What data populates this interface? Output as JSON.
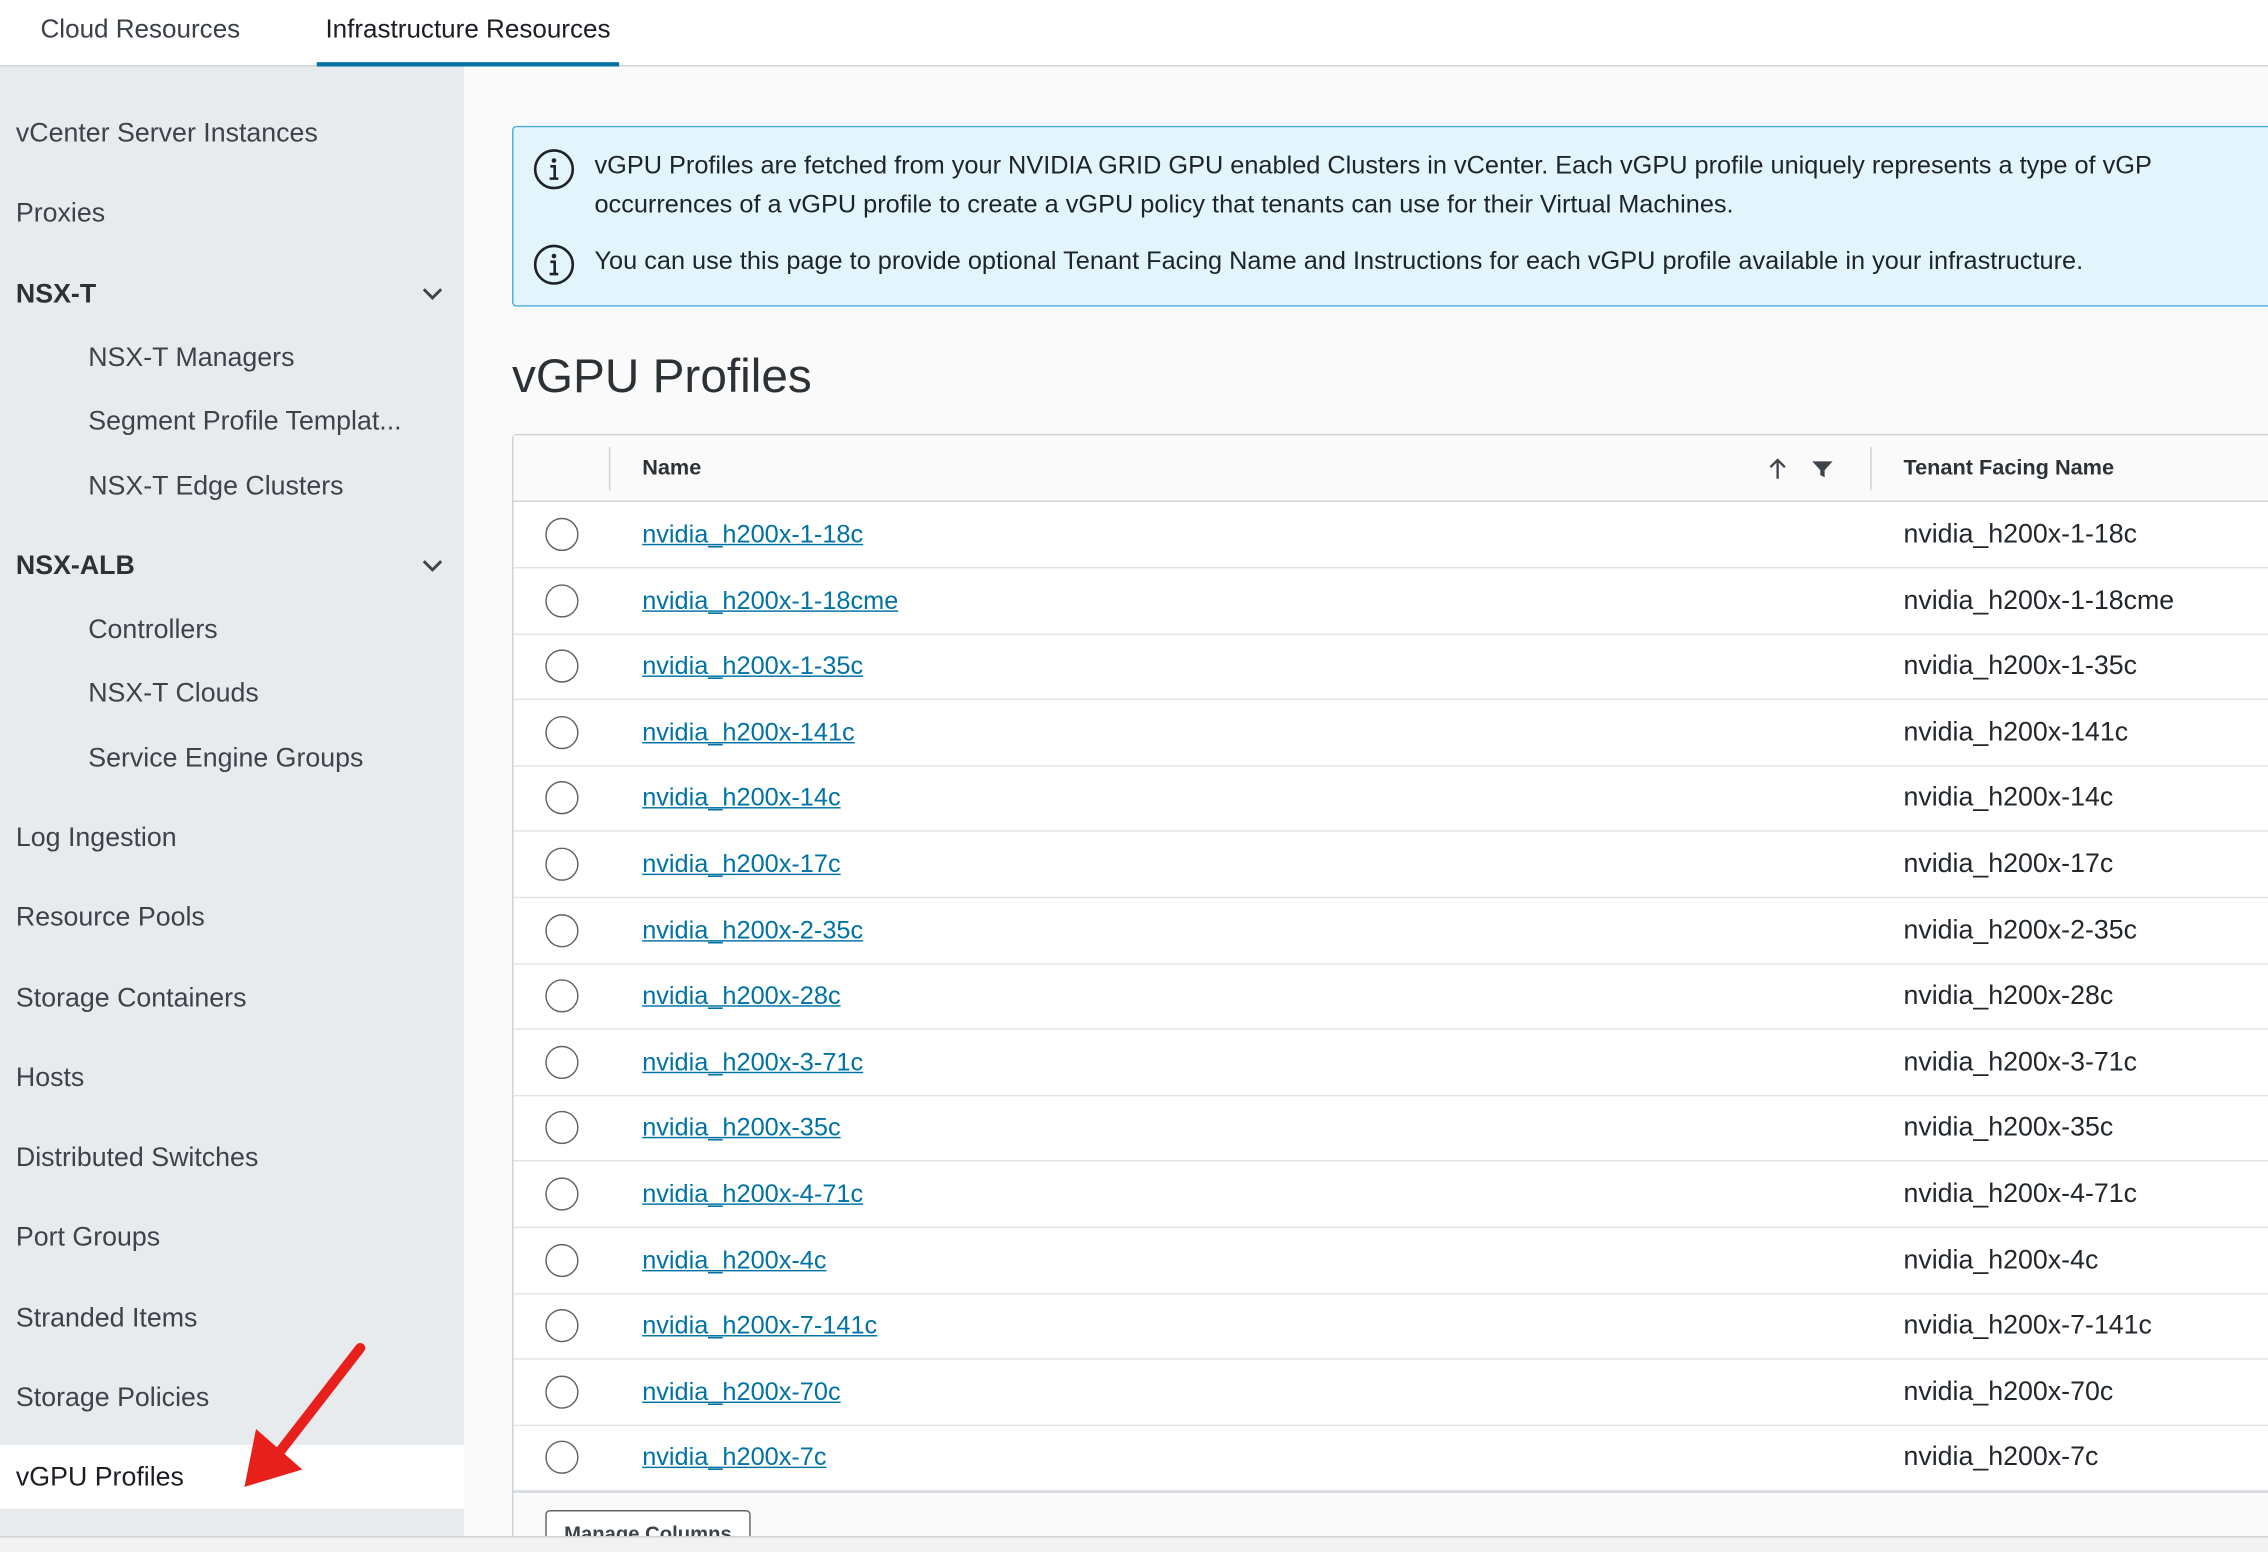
{
  "tabs": [
    {
      "label": "Cloud Resources"
    },
    {
      "label": "Infrastructure Resources"
    }
  ],
  "sidebar": {
    "items": [
      {
        "label": "vCenter Server Instances"
      },
      {
        "label": "Proxies"
      },
      {
        "label": "NSX-T"
      },
      {
        "label": "NSX-T Managers"
      },
      {
        "label": "Segment Profile Templat..."
      },
      {
        "label": "NSX-T Edge Clusters"
      },
      {
        "label": "NSX-ALB"
      },
      {
        "label": "Controllers"
      },
      {
        "label": "NSX-T Clouds"
      },
      {
        "label": "Service Engine Groups"
      },
      {
        "label": "Log Ingestion"
      },
      {
        "label": "Resource Pools"
      },
      {
        "label": "Storage Containers"
      },
      {
        "label": "Hosts"
      },
      {
        "label": "Distributed Switches"
      },
      {
        "label": "Port Groups"
      },
      {
        "label": "Stranded Items"
      },
      {
        "label": "Storage Policies"
      },
      {
        "label": "vGPU Profiles"
      }
    ]
  },
  "alert": {
    "line1": "vGPU Profiles are fetched from your NVIDIA GRID GPU enabled Clusters in vCenter. Each vGPU profile uniquely represents a type of vGP",
    "line2": "occurrences of a vGPU profile to create a vGPU policy that tenants can use for their Virtual Machines.",
    "line3": "You can use this page to provide optional Tenant Facing Name and Instructions for each vGPU profile available in your infrastructure."
  },
  "page": {
    "title": "vGPU Profiles"
  },
  "grid": {
    "columns": {
      "name": "Name",
      "tenant": "Tenant Facing Name"
    },
    "rows": [
      {
        "name": "nvidia_h200x-1-18c",
        "tenant": "nvidia_h200x-1-18c"
      },
      {
        "name": "nvidia_h200x-1-18cme",
        "tenant": "nvidia_h200x-1-18cme"
      },
      {
        "name": "nvidia_h200x-1-35c",
        "tenant": "nvidia_h200x-1-35c"
      },
      {
        "name": "nvidia_h200x-141c",
        "tenant": "nvidia_h200x-141c"
      },
      {
        "name": "nvidia_h200x-14c",
        "tenant": "nvidia_h200x-14c"
      },
      {
        "name": "nvidia_h200x-17c",
        "tenant": "nvidia_h200x-17c"
      },
      {
        "name": "nvidia_h200x-2-35c",
        "tenant": "nvidia_h200x-2-35c"
      },
      {
        "name": "nvidia_h200x-28c",
        "tenant": "nvidia_h200x-28c"
      },
      {
        "name": "nvidia_h200x-3-71c",
        "tenant": "nvidia_h200x-3-71c"
      },
      {
        "name": "nvidia_h200x-35c",
        "tenant": "nvidia_h200x-35c"
      },
      {
        "name": "nvidia_h200x-4-71c",
        "tenant": "nvidia_h200x-4-71c"
      },
      {
        "name": "nvidia_h200x-4c",
        "tenant": "nvidia_h200x-4c"
      },
      {
        "name": "nvidia_h200x-7-141c",
        "tenant": "nvidia_h200x-7-141c"
      },
      {
        "name": "nvidia_h200x-70c",
        "tenant": "nvidia_h200x-70c"
      },
      {
        "name": "nvidia_h200x-7c",
        "tenant": "nvidia_h200x-7c"
      }
    ],
    "manage_columns_label": "Manage Columns"
  },
  "colors": {
    "accent": "#0072a3",
    "sidebar_bg": "#e8ebee",
    "alert_bg": "#e3f5fc",
    "annotation_arrow": "#e8201c"
  }
}
